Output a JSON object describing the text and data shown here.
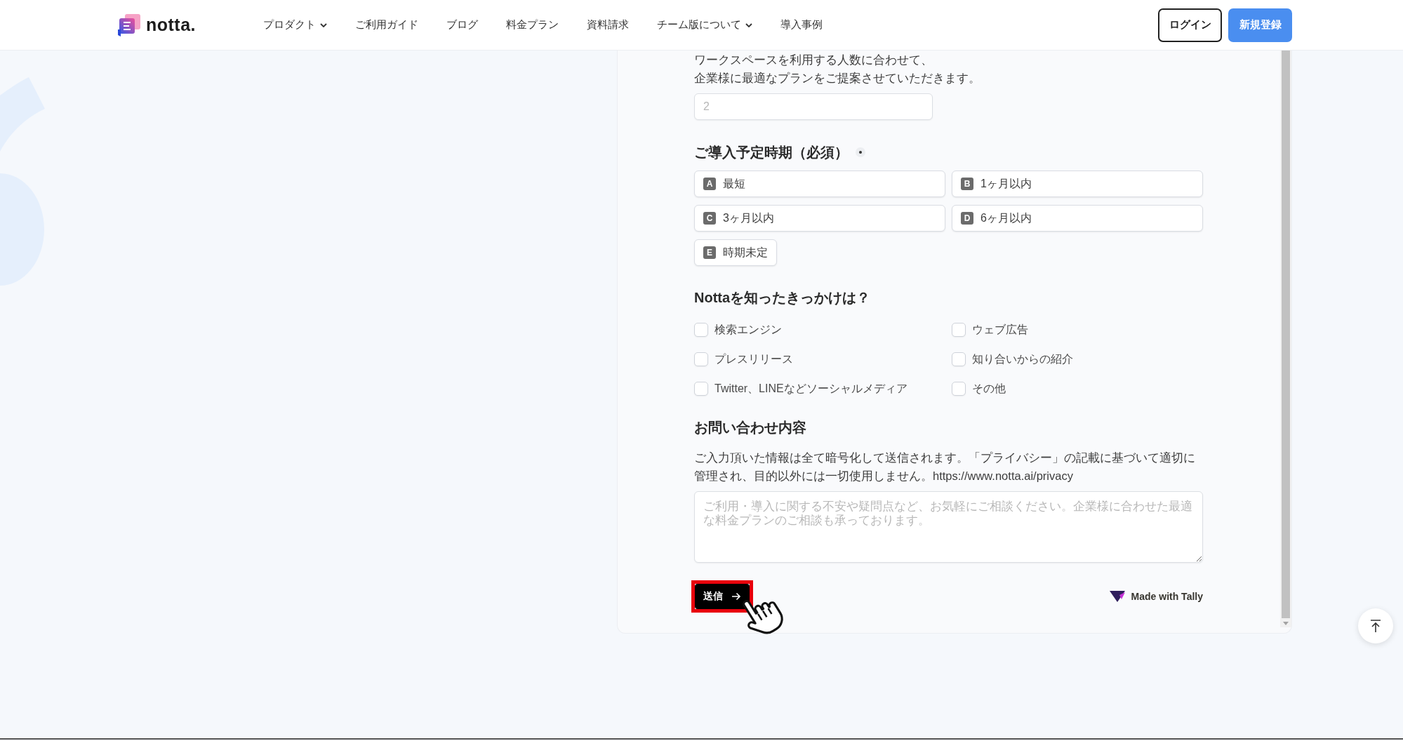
{
  "header": {
    "logo_text": "notta.",
    "nav": [
      {
        "label": "プロダクト",
        "dropdown": true
      },
      {
        "label": "ご利用ガイド",
        "dropdown": false
      },
      {
        "label": "ブログ",
        "dropdown": false
      },
      {
        "label": "料金プラン",
        "dropdown": false
      },
      {
        "label": "資料請求",
        "dropdown": false
      },
      {
        "label": "チーム版について",
        "dropdown": true
      },
      {
        "label": "導入事例",
        "dropdown": false
      }
    ],
    "buttons": [
      {
        "label": "ログイン",
        "kind": "outline"
      },
      {
        "label": "新規登録",
        "kind": "primary"
      }
    ]
  },
  "form": {
    "intro": [
      "ワークスペースを利用する人数に合わせて、",
      "企業様に最適なプランをご提案させていただきます。"
    ],
    "count_field": {
      "placeholder": "2"
    },
    "timing": {
      "title": "ご導入予定時期（必須）",
      "required": true,
      "options": [
        {
          "key": "A",
          "label": "最短",
          "selected": false
        },
        {
          "key": "B",
          "label": "1ヶ月以内",
          "selected": false
        },
        {
          "key": "C",
          "label": "3ヶ月以内",
          "selected": false
        },
        {
          "key": "D",
          "label": "6ヶ月以内",
          "selected": false
        },
        {
          "key": "E",
          "label": "時期未定",
          "selected": false
        }
      ]
    },
    "source": {
      "title": "Nottaを知ったきっかけは？",
      "options": [
        {
          "label": "検索エンジン",
          "checked": false
        },
        {
          "label": "ウェブ広告",
          "checked": false
        },
        {
          "label": "プレスリリース",
          "checked": false
        },
        {
          "label": "知り合いからの紹介",
          "checked": false
        },
        {
          "label": "Twitter、LINEなどソーシャルメディア",
          "checked": false
        },
        {
          "label": "その他",
          "checked": false
        }
      ]
    },
    "inquiry": {
      "title": "お問い合わせ内容",
      "note": "ご入力頂いた情報は全て暗号化して送信されます。「プライバシー」の記載に基づいて適切に管理され、目的以外には一切使用しません。https://www.notta.ai/privacy",
      "placeholder": "ご利用・導入に関する不安や疑問点など、お気軽にご相談ください。企業様に合わせた最適な料金プランのご相談も承っております。"
    },
    "submit": {
      "label": "送信",
      "highlighted": true
    },
    "branding": "Made with Tally"
  }
}
